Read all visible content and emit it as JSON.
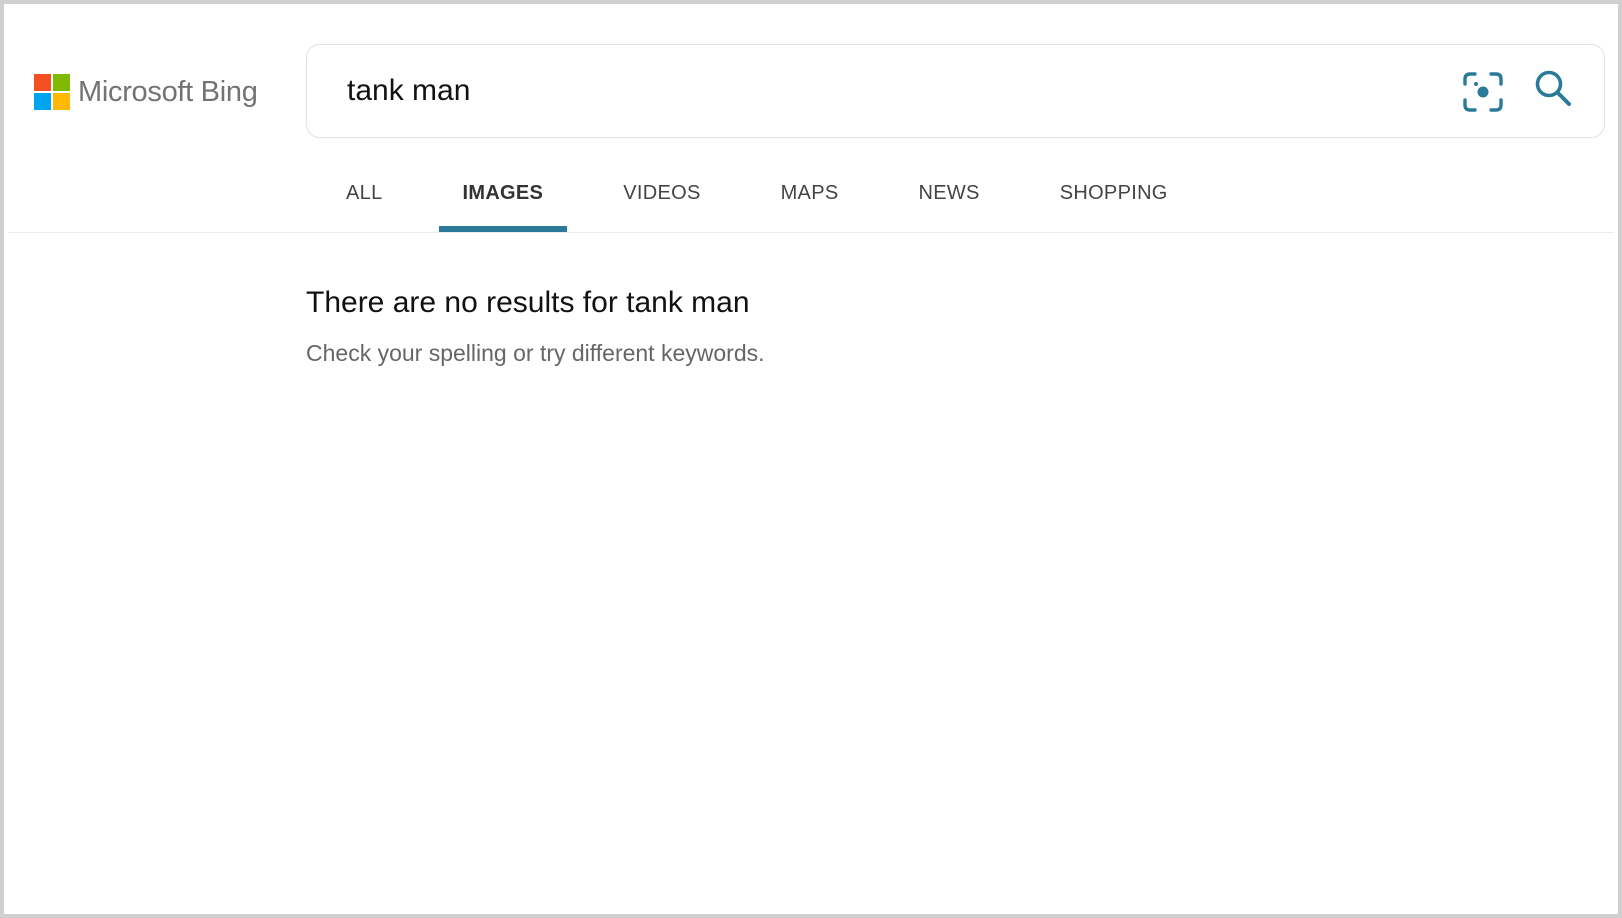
{
  "brand": {
    "logo_text": "Microsoft Bing",
    "logo_icon": "microsoft-logo-icon",
    "logo_colors": [
      "#f25022",
      "#7fba00",
      "#00a4ef",
      "#ffb900"
    ]
  },
  "search": {
    "query": "tank man",
    "visual_search_icon": "visual-search-icon",
    "search_icon": "magnifier-icon"
  },
  "tabs": [
    {
      "label": "ALL",
      "active": false
    },
    {
      "label": "IMAGES",
      "active": true
    },
    {
      "label": "VIDEOS",
      "active": false
    },
    {
      "label": "MAPS",
      "active": false
    },
    {
      "label": "NEWS",
      "active": false
    },
    {
      "label": "SHOPPING",
      "active": false
    }
  ],
  "results": {
    "title": "There are no results for tank man",
    "hint": "Check your spelling or try different keywords."
  },
  "colors": {
    "accent": "#2b7a9a",
    "icon": "#2b7a9a"
  }
}
